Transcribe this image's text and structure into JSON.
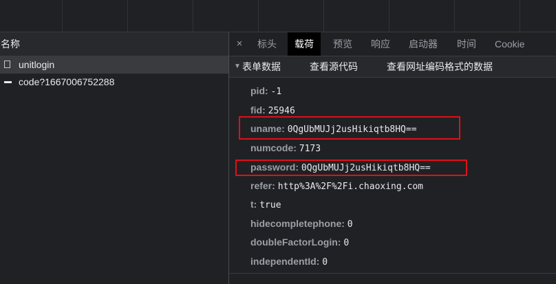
{
  "left_panel": {
    "header": "名称",
    "requests": [
      {
        "name": "unitlogin"
      },
      {
        "name": "code?1667006752288"
      }
    ]
  },
  "right_panel": {
    "close_glyph": "×",
    "tabs": [
      "标头",
      "载荷",
      "预览",
      "响应",
      "启动器",
      "时间",
      "Cookie"
    ],
    "active_tab": "载荷",
    "section": {
      "toggle_glyph": "▼",
      "title": "表单数据",
      "view_source": "查看源代码",
      "view_url_encoded": "查看网址编码格式的数据"
    },
    "params": [
      {
        "key": "pid:",
        "value": "-1"
      },
      {
        "key": "fid:",
        "value": "25946"
      },
      {
        "key": "uname:",
        "value": "0QgUbMUJj2usHikiqtb8HQ=="
      },
      {
        "key": "numcode:",
        "value": "7173"
      },
      {
        "key": "password:",
        "value": "0QgUbMUJj2usHikiqtb8HQ=="
      },
      {
        "key": "refer:",
        "value": "http%3A%2F%2Fi.chaoxing.com"
      },
      {
        "key": "t:",
        "value": "true"
      },
      {
        "key": "hidecompletephone:",
        "value": "0"
      },
      {
        "key": "doubleFactorLogin:",
        "value": "0"
      },
      {
        "key": "independentId:",
        "value": "0"
      }
    ]
  },
  "colors": {
    "background": "#202124",
    "text": "#e8eaed",
    "muted_key": "#9aa0a6",
    "active_tab_bg": "#000000",
    "highlight_box": "#e0101a"
  }
}
